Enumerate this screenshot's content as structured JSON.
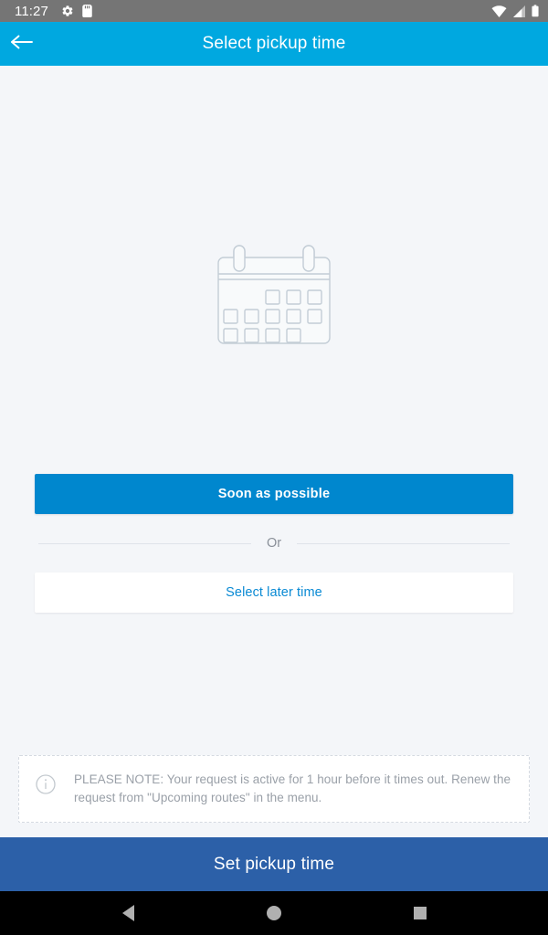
{
  "status_bar": {
    "time": "11:27",
    "left_icons": [
      "gear-icon",
      "sd-card-icon"
    ],
    "right_icons": [
      "wifi-icon",
      "cellular-signal-icon",
      "battery-icon"
    ],
    "background": "#757575"
  },
  "app_bar": {
    "back_icon": "arrow-left-icon",
    "title": "Select pickup time",
    "background": "#00a8e0"
  },
  "illustration": {
    "name": "calendar-illustration",
    "stroke_color": "#c3cdd6"
  },
  "main": {
    "primary_button_label": "Soon as possible",
    "divider_label": "Or",
    "secondary_button_label": "Select later time",
    "primary_color": "#0087ce",
    "secondary_text_color": "#0a8ad4"
  },
  "note": {
    "icon": "info-circle-icon",
    "text": "PLEASE NOTE: Your request is active for 1 hour before it times out. Renew the request from \"Upcoming routes\" in the menu."
  },
  "bottom_cta": {
    "label": "Set pickup time",
    "background": "#2c60a8"
  },
  "nav_bar": {
    "back_label": "back-triangle-icon",
    "home_label": "home-circle-icon",
    "recents_label": "recents-square-icon"
  }
}
